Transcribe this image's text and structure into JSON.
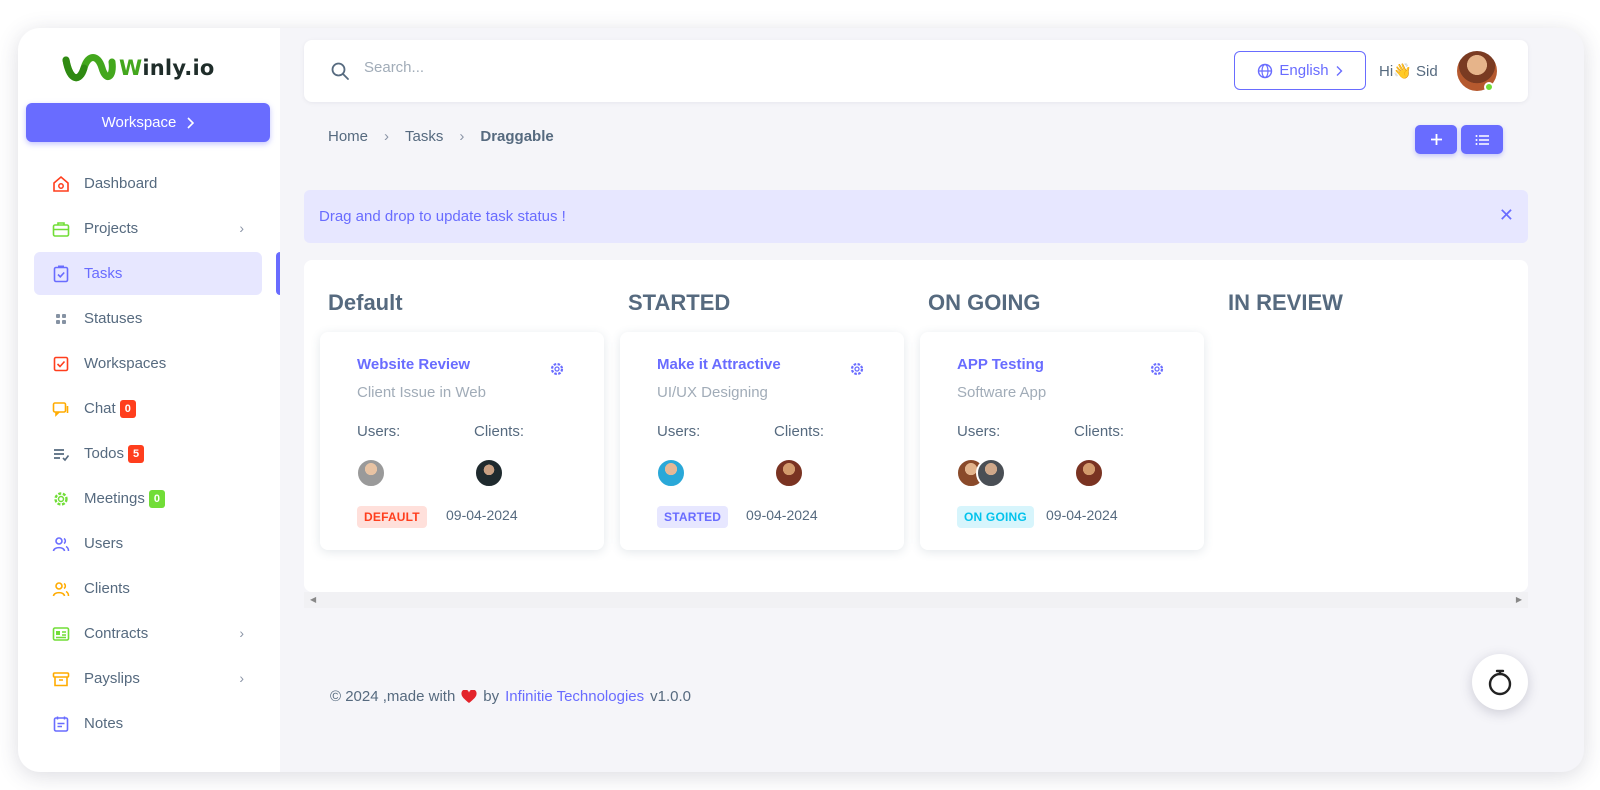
{
  "brand": {
    "name": "Winly.io",
    "name_first": "W",
    "name_rest": "inly.io"
  },
  "sidebar": {
    "workspace_label": "Workspace",
    "items": [
      {
        "label": "Dashboard",
        "icon": "home-icon",
        "color": "#ff3e1d"
      },
      {
        "label": "Projects",
        "icon": "briefcase-icon",
        "color": "#71dd37",
        "chevron": true
      },
      {
        "label": "Tasks",
        "icon": "task-icon",
        "color": "#696cff",
        "active": true
      },
      {
        "label": "Statuses",
        "icon": "grid-dots-icon",
        "color": "#8592a3"
      },
      {
        "label": "Workspaces",
        "icon": "checkbox-icon",
        "color": "#ff3e1d"
      },
      {
        "label": "Chat",
        "icon": "chat-icon",
        "color": "#ffab00",
        "badge": "0",
        "badge_color": "red"
      },
      {
        "label": "Todos",
        "icon": "todo-list-icon",
        "color": "#566a7f",
        "badge": "5",
        "badge_color": "red"
      },
      {
        "label": "Meetings",
        "icon": "gear-badge-icon",
        "color": "#71dd37",
        "badge": "0",
        "badge_color": "green"
      },
      {
        "label": "Users",
        "icon": "users-icon",
        "color": "#696cff"
      },
      {
        "label": "Clients",
        "icon": "clients-icon",
        "color": "#ffab00"
      },
      {
        "label": "Contracts",
        "icon": "contract-icon",
        "color": "#71dd37",
        "chevron": true
      },
      {
        "label": "Payslips",
        "icon": "archive-icon",
        "color": "#ffab00",
        "chevron": true
      },
      {
        "label": "Notes",
        "icon": "notes-icon",
        "color": "#696cff"
      }
    ]
  },
  "topbar": {
    "search_placeholder": "Search...",
    "language": "English",
    "greeting": "Hi👋 Sid"
  },
  "breadcrumb": {
    "home": "Home",
    "section": "Tasks",
    "current": "Draggable"
  },
  "alert": {
    "message": "Drag and drop to update task status !"
  },
  "board": {
    "columns": [
      {
        "title": "Default",
        "card": {
          "title": "Website Review",
          "subtitle": "Client Issue in Web",
          "users_label": "Users:",
          "clients_label": "Clients:",
          "status": "DEFAULT",
          "date": "09-04-2024"
        }
      },
      {
        "title": "STARTED",
        "card": {
          "title": "Make it Attractive",
          "subtitle": "UI/UX Designing",
          "users_label": "Users:",
          "clients_label": "Clients:",
          "status": "STARTED",
          "date": "09-04-2024"
        }
      },
      {
        "title": "ON GOING",
        "card": {
          "title": "APP Testing",
          "subtitle": "Software App",
          "users_label": "Users:",
          "clients_label": "Clients:",
          "status": "ON GOING",
          "date": "09-04-2024"
        }
      },
      {
        "title": "IN REVIEW"
      }
    ]
  },
  "footer": {
    "prefix": "© 2024 ,made with",
    "by": "by",
    "company": "Infinitie Technologies",
    "version": "v1.0.0"
  },
  "colors": {
    "primary": "#696cff",
    "danger": "#ff3e1d",
    "success": "#71dd37",
    "info": "#03c3ec",
    "warning": "#ffab00"
  }
}
